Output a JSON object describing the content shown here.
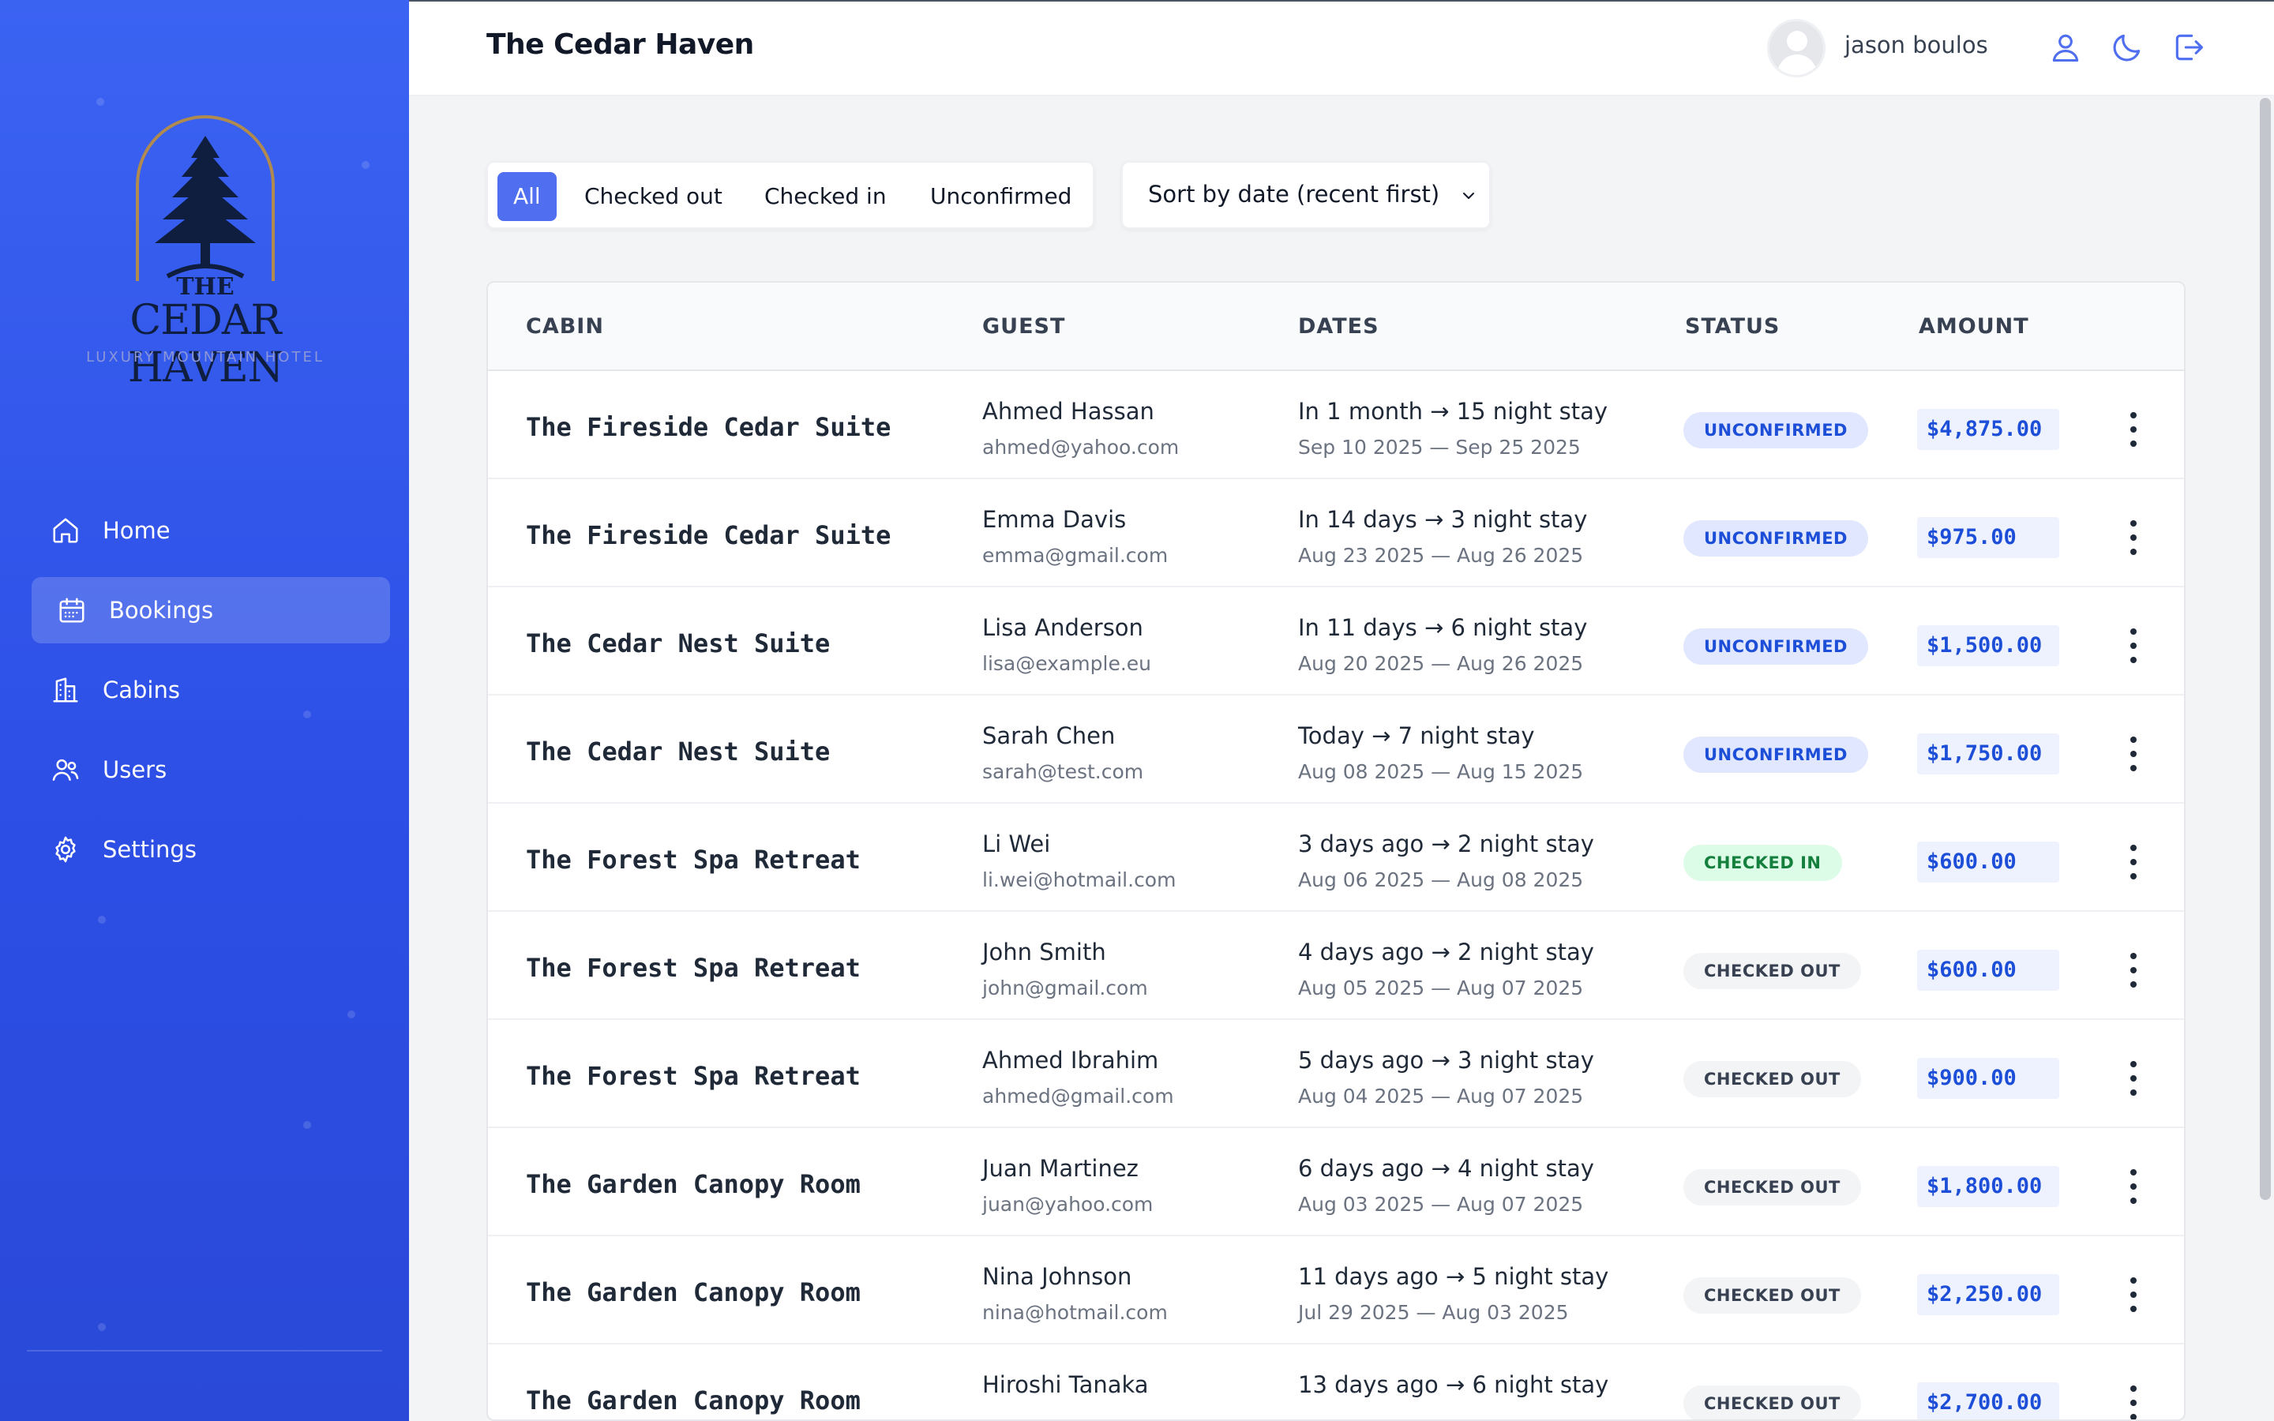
{
  "app": {
    "title": "The Cedar Haven"
  },
  "brand": {
    "logo_the": "THE",
    "logo_name": "CEDAR HAVEN",
    "logo_tagline": "LUXURY MOUNTAIN HOTEL",
    "accent": "#4f6ef0",
    "sidebar_color": "#3358ec"
  },
  "sidebar": {
    "items": [
      {
        "label": "Home",
        "icon": "home-icon",
        "active": false
      },
      {
        "label": "Bookings",
        "icon": "calendar-icon",
        "active": true
      },
      {
        "label": "Cabins",
        "icon": "building-icon",
        "active": false
      },
      {
        "label": "Users",
        "icon": "users-icon",
        "active": false
      },
      {
        "label": "Settings",
        "icon": "gear-icon",
        "active": false
      }
    ]
  },
  "header": {
    "user_name": "jason boulos",
    "icons": [
      "user-icon",
      "moon-icon",
      "logout-icon"
    ]
  },
  "filters": {
    "options": [
      "All",
      "Checked out",
      "Checked in",
      "Unconfirmed"
    ],
    "active": "All"
  },
  "sort": {
    "selected": "Sort by date (recent first)"
  },
  "table": {
    "columns": [
      "CABIN",
      "GUEST",
      "DATES",
      "STATUS",
      "AMOUNT"
    ],
    "rows": [
      {
        "cabin": "The Fireside Cedar Suite",
        "guest": "Ahmed Hassan",
        "email": "ahmed@yahoo.com",
        "stay": "In 1 month → 15 night stay",
        "range": "Sep 10 2025 — Sep 25 2025",
        "status": "UNCONFIRMED",
        "amount": "$4,875.00"
      },
      {
        "cabin": "The Fireside Cedar Suite",
        "guest": "Emma Davis",
        "email": "emma@gmail.com",
        "stay": "In 14 days → 3 night stay",
        "range": "Aug 23 2025 — Aug 26 2025",
        "status": "UNCONFIRMED",
        "amount": "$975.00"
      },
      {
        "cabin": "The Cedar Nest Suite",
        "guest": "Lisa Anderson",
        "email": "lisa@example.eu",
        "stay": "In 11 days → 6 night stay",
        "range": "Aug 20 2025 — Aug 26 2025",
        "status": "UNCONFIRMED",
        "amount": "$1,500.00"
      },
      {
        "cabin": "The Cedar Nest Suite",
        "guest": "Sarah Chen",
        "email": "sarah@test.com",
        "stay": "Today → 7 night stay",
        "range": "Aug 08 2025 — Aug 15 2025",
        "status": "UNCONFIRMED",
        "amount": "$1,750.00"
      },
      {
        "cabin": "The Forest Spa Retreat",
        "guest": "Li Wei",
        "email": "li.wei@hotmail.com",
        "stay": "3 days ago → 2 night stay",
        "range": "Aug 06 2025 — Aug 08 2025",
        "status": "CHECKED IN",
        "amount": "$600.00"
      },
      {
        "cabin": "The Forest Spa Retreat",
        "guest": "John Smith",
        "email": "john@gmail.com",
        "stay": "4 days ago → 2 night stay",
        "range": "Aug 05 2025 — Aug 07 2025",
        "status": "CHECKED OUT",
        "amount": "$600.00"
      },
      {
        "cabin": "The Forest Spa Retreat",
        "guest": "Ahmed Ibrahim",
        "email": "ahmed@gmail.com",
        "stay": "5 days ago → 3 night stay",
        "range": "Aug 04 2025 — Aug 07 2025",
        "status": "CHECKED OUT",
        "amount": "$900.00"
      },
      {
        "cabin": "The Garden Canopy Room",
        "guest": "Juan Martinez",
        "email": "juan@yahoo.com",
        "stay": "6 days ago → 4 night stay",
        "range": "Aug 03 2025 — Aug 07 2025",
        "status": "CHECKED OUT",
        "amount": "$1,800.00"
      },
      {
        "cabin": "The Garden Canopy Room",
        "guest": "Nina Johnson",
        "email": "nina@hotmail.com",
        "stay": "11 days ago → 5 night stay",
        "range": "Jul 29 2025 — Aug 03 2025",
        "status": "CHECKED OUT",
        "amount": "$2,250.00"
      },
      {
        "cabin": "The Garden Canopy Room",
        "guest": "Hiroshi Tanaka",
        "email": "",
        "stay": "13 days ago → 6 night stay",
        "range": "",
        "status": "CHECKED OUT",
        "amount": "$2,700.00"
      }
    ]
  }
}
